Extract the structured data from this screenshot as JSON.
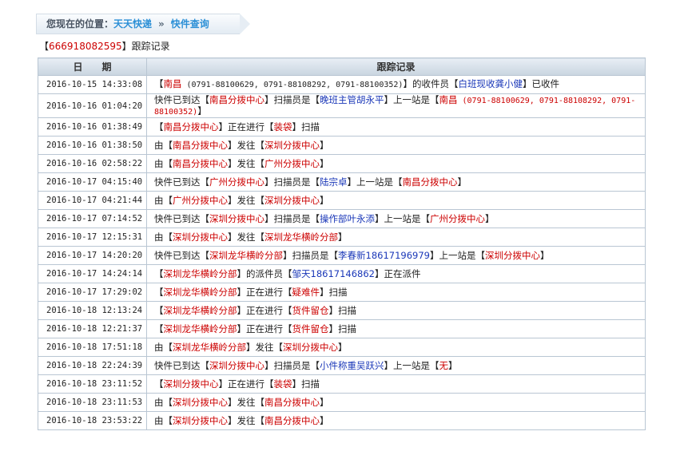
{
  "breadcrumb": {
    "label": "您现在的位置：",
    "item1": "天天快递",
    "sep": "»",
    "item2": "快件查询"
  },
  "tracking": {
    "number": "666918082595",
    "suffix": "跟踪记录"
  },
  "table": {
    "col_date": "日　　期",
    "col_record": "跟踪记录"
  },
  "rows": [
    {
      "date": "2016-10-15 14:33:08",
      "parts": [
        [
          "k",
          "【"
        ],
        [
          "r",
          "南昌"
        ],
        [
          "s",
          " (0791-88100629, 0791-88108292, 0791-88100352)"
        ],
        [
          "k",
          "】的收件员【"
        ],
        [
          "b",
          "白班现收龚小健"
        ],
        [
          "k",
          "】已收件"
        ]
      ]
    },
    {
      "date": "2016-10-16 01:04:20",
      "tall": true,
      "parts": [
        [
          "k",
          "快件已到达【"
        ],
        [
          "r",
          "南昌分拨中心"
        ],
        [
          "k",
          "】扫描员是【"
        ],
        [
          "b",
          "晚班主管胡永平"
        ],
        [
          "k",
          "】上一站是【"
        ],
        [
          "r",
          "南昌"
        ],
        [
          "rs",
          " (0791-88100629, 0791-88108292, 0791-88100352)"
        ],
        [
          "k",
          "】"
        ]
      ]
    },
    {
      "date": "2016-10-16 01:38:49",
      "parts": [
        [
          "k",
          "【"
        ],
        [
          "r",
          "南昌分拨中心"
        ],
        [
          "k",
          "】正在进行【"
        ],
        [
          "r",
          "装袋"
        ],
        [
          "k",
          "】扫描"
        ]
      ]
    },
    {
      "date": "2016-10-16 01:38:50",
      "parts": [
        [
          "k",
          "由【"
        ],
        [
          "r",
          "南昌分拨中心"
        ],
        [
          "k",
          "】发往【"
        ],
        [
          "r",
          "深圳分拨中心"
        ],
        [
          "k",
          "】"
        ]
      ]
    },
    {
      "date": "2016-10-16 02:58:22",
      "parts": [
        [
          "k",
          "由【"
        ],
        [
          "r",
          "南昌分拨中心"
        ],
        [
          "k",
          "】发往【"
        ],
        [
          "r",
          "广州分拨中心"
        ],
        [
          "k",
          "】"
        ]
      ]
    },
    {
      "date": "2016-10-17 04:15:40",
      "parts": [
        [
          "k",
          "快件已到达【"
        ],
        [
          "r",
          "广州分拨中心"
        ],
        [
          "k",
          "】扫描员是【"
        ],
        [
          "b",
          "陆宗卓"
        ],
        [
          "k",
          "】上一站是【"
        ],
        [
          "r",
          "南昌分拨中心"
        ],
        [
          "k",
          "】"
        ]
      ]
    },
    {
      "date": "2016-10-17 04:21:44",
      "parts": [
        [
          "k",
          "由【"
        ],
        [
          "r",
          "广州分拨中心"
        ],
        [
          "k",
          "】发往【"
        ],
        [
          "r",
          "深圳分拨中心"
        ],
        [
          "k",
          "】"
        ]
      ]
    },
    {
      "date": "2016-10-17 07:14:52",
      "parts": [
        [
          "k",
          "快件已到达【"
        ],
        [
          "r",
          "深圳分拨中心"
        ],
        [
          "k",
          "】扫描员是【"
        ],
        [
          "b",
          "操作部叶永添"
        ],
        [
          "k",
          "】上一站是【"
        ],
        [
          "r",
          "广州分拨中心"
        ],
        [
          "k",
          "】"
        ]
      ]
    },
    {
      "date": "2016-10-17 12:15:31",
      "parts": [
        [
          "k",
          "由【"
        ],
        [
          "r",
          "深圳分拨中心"
        ],
        [
          "k",
          "】发往【"
        ],
        [
          "r",
          "深圳龙华横岭分部"
        ],
        [
          "k",
          "】"
        ]
      ]
    },
    {
      "date": "2016-10-17 14:20:20",
      "parts": [
        [
          "k",
          "快件已到达【"
        ],
        [
          "r",
          "深圳龙华横岭分部"
        ],
        [
          "k",
          "】扫描员是【"
        ],
        [
          "b",
          "李春新18617196979"
        ],
        [
          "k",
          "】上一站是【"
        ],
        [
          "r",
          "深圳分拨中心"
        ],
        [
          "k",
          "】"
        ]
      ]
    },
    {
      "date": "2016-10-17 14:24:14",
      "parts": [
        [
          "k",
          "【"
        ],
        [
          "r",
          "深圳龙华横岭分部"
        ],
        [
          "k",
          "】的派件员【"
        ],
        [
          "b",
          "邹天18617146862"
        ],
        [
          "k",
          "】正在派件"
        ]
      ]
    },
    {
      "date": "2016-10-17 17:29:02",
      "parts": [
        [
          "k",
          "【"
        ],
        [
          "r",
          "深圳龙华横岭分部"
        ],
        [
          "k",
          "】正在进行【"
        ],
        [
          "r",
          "疑难件"
        ],
        [
          "k",
          "】扫描"
        ]
      ]
    },
    {
      "date": "2016-10-18 12:13:24",
      "parts": [
        [
          "k",
          "【"
        ],
        [
          "r",
          "深圳龙华横岭分部"
        ],
        [
          "k",
          "】正在进行【"
        ],
        [
          "r",
          "货件留仓"
        ],
        [
          "k",
          "】扫描"
        ]
      ]
    },
    {
      "date": "2016-10-18 12:21:37",
      "parts": [
        [
          "k",
          "【"
        ],
        [
          "r",
          "深圳龙华横岭分部"
        ],
        [
          "k",
          "】正在进行【"
        ],
        [
          "r",
          "货件留仓"
        ],
        [
          "k",
          "】扫描"
        ]
      ]
    },
    {
      "date": "2016-10-18 17:51:18",
      "parts": [
        [
          "k",
          "由【"
        ],
        [
          "r",
          "深圳龙华横岭分部"
        ],
        [
          "k",
          "】发往【"
        ],
        [
          "r",
          "深圳分拨中心"
        ],
        [
          "k",
          "】"
        ]
      ]
    },
    {
      "date": "2016-10-18 22:24:39",
      "parts": [
        [
          "k",
          "快件已到达【"
        ],
        [
          "r",
          "深圳分拨中心"
        ],
        [
          "k",
          "】扫描员是【"
        ],
        [
          "b",
          "小件称重吴跃兴"
        ],
        [
          "k",
          "】上一站是【"
        ],
        [
          "r",
          "无"
        ],
        [
          "k",
          "】"
        ]
      ]
    },
    {
      "date": "2016-10-18 23:11:52",
      "parts": [
        [
          "k",
          "【"
        ],
        [
          "r",
          "深圳分拨中心"
        ],
        [
          "k",
          "】正在进行【"
        ],
        [
          "r",
          "装袋"
        ],
        [
          "k",
          "】扫描"
        ]
      ]
    },
    {
      "date": "2016-10-18 23:11:53",
      "parts": [
        [
          "k",
          "由【"
        ],
        [
          "r",
          "深圳分拨中心"
        ],
        [
          "k",
          "】发往【"
        ],
        [
          "r",
          "南昌分拨中心"
        ],
        [
          "k",
          "】"
        ]
      ]
    },
    {
      "date": "2016-10-18 23:53:22",
      "parts": [
        [
          "k",
          "由【"
        ],
        [
          "r",
          "深圳分拨中心"
        ],
        [
          "k",
          "】发往【"
        ],
        [
          "r",
          "南昌分拨中心"
        ],
        [
          "k",
          "】"
        ]
      ]
    }
  ]
}
